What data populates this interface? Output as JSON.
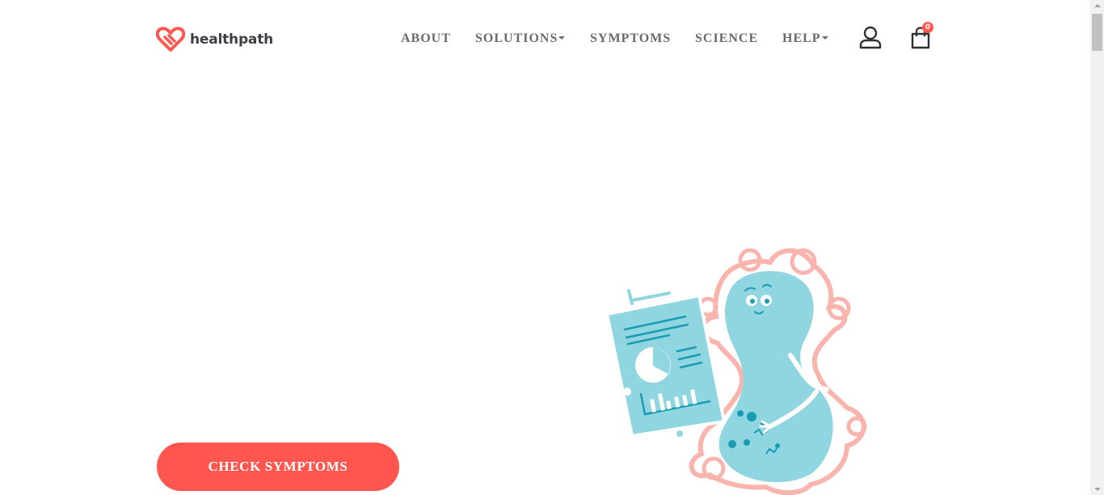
{
  "brand": {
    "name": "healthpath",
    "color": "#ff5750",
    "text_color": "#3c3f44"
  },
  "nav": {
    "items": [
      {
        "label": "ABOUT",
        "has_dropdown": false
      },
      {
        "label": "SOLUTIONS",
        "has_dropdown": true
      },
      {
        "label": "SYMPTOMS",
        "has_dropdown": false
      },
      {
        "label": "SCIENCE",
        "has_dropdown": false
      },
      {
        "label": "HELP",
        "has_dropdown": true
      }
    ],
    "account_icon": "user-icon",
    "cart_icon": "shopping-bag-icon",
    "cart_count": "0"
  },
  "hero": {
    "cta_label": "CHECK SYMPTOMS",
    "illustration": "gut-microbe-character-holding-report",
    "colors": {
      "accent": "#ff5750",
      "character": "#8fd6e1",
      "outline": "#f9b5ad",
      "detail": "#1a9bb3"
    }
  }
}
